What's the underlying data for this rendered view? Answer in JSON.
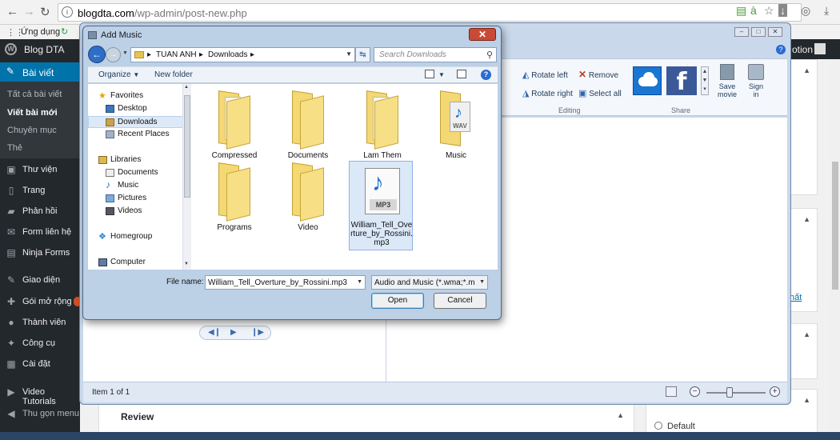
{
  "browser": {
    "url_host": "blogdta.com",
    "url_path": "/wp-admin/post-new.php",
    "bookmark_label": "Ứng dụng"
  },
  "adminbar": {
    "site_name": "Blog DTA",
    "right_text": "otion"
  },
  "sidebar": {
    "active": "Bài viết",
    "submenu": [
      "Tất cả bài viết",
      "Viết bài mới",
      "Chuyên mục",
      "Thẻ"
    ],
    "items": [
      "Thư viện",
      "Trang",
      "Phản hồi",
      "Form liên hệ",
      "Ninja Forms",
      "Giao diện",
      "Gói mở rộng",
      "Thành viên",
      "Công cụ",
      "Cài đặt",
      "Video Tutorials",
      "Thu gọn menu"
    ]
  },
  "wp": {
    "review_title": "Review",
    "radio_default": "Default",
    "link_text": "hất"
  },
  "movie_maker": {
    "rotate_left": "Rotate left",
    "rotate_right": "Rotate right",
    "remove": "Remove",
    "select_all": "Select all",
    "group_editing": "Editing",
    "group_share": "Share",
    "save_movie": "Save movie",
    "sign_in": "Sign in",
    "status": "Item 1 of 1"
  },
  "dialog": {
    "title": "Add Music",
    "breadcrumb": [
      "TUAN ANH",
      "Downloads"
    ],
    "search_placeholder": "Search Downloads",
    "organize": "Organize",
    "new_folder": "New folder",
    "nav": {
      "favorites": "Favorites",
      "desktop": "Desktop",
      "downloads": "Downloads",
      "recent": "Recent Places",
      "libraries": "Libraries",
      "documents": "Documents",
      "music": "Music",
      "pictures": "Pictures",
      "videos": "Videos",
      "homegroup": "Homegroup",
      "computer": "Computer"
    },
    "files": [
      "Compressed",
      "Documents",
      "Lam Them",
      "Music",
      "Programs",
      "Video"
    ],
    "selected_file": "William_Tell_Overture_by_Rossini.mp3",
    "selected_file_lines": [
      "William_Tell_Ove",
      "rture_by_Rossini.",
      "mp3"
    ],
    "wav_label": "WAV",
    "mp3_label": "MP3",
    "file_name_label": "File name:",
    "file_name_value": "William_Tell_Overture_by_Rossini.mp3",
    "file_type_value": "Audio and Music (*.wma;*.mp3",
    "open": "Open",
    "cancel": "Cancel"
  }
}
